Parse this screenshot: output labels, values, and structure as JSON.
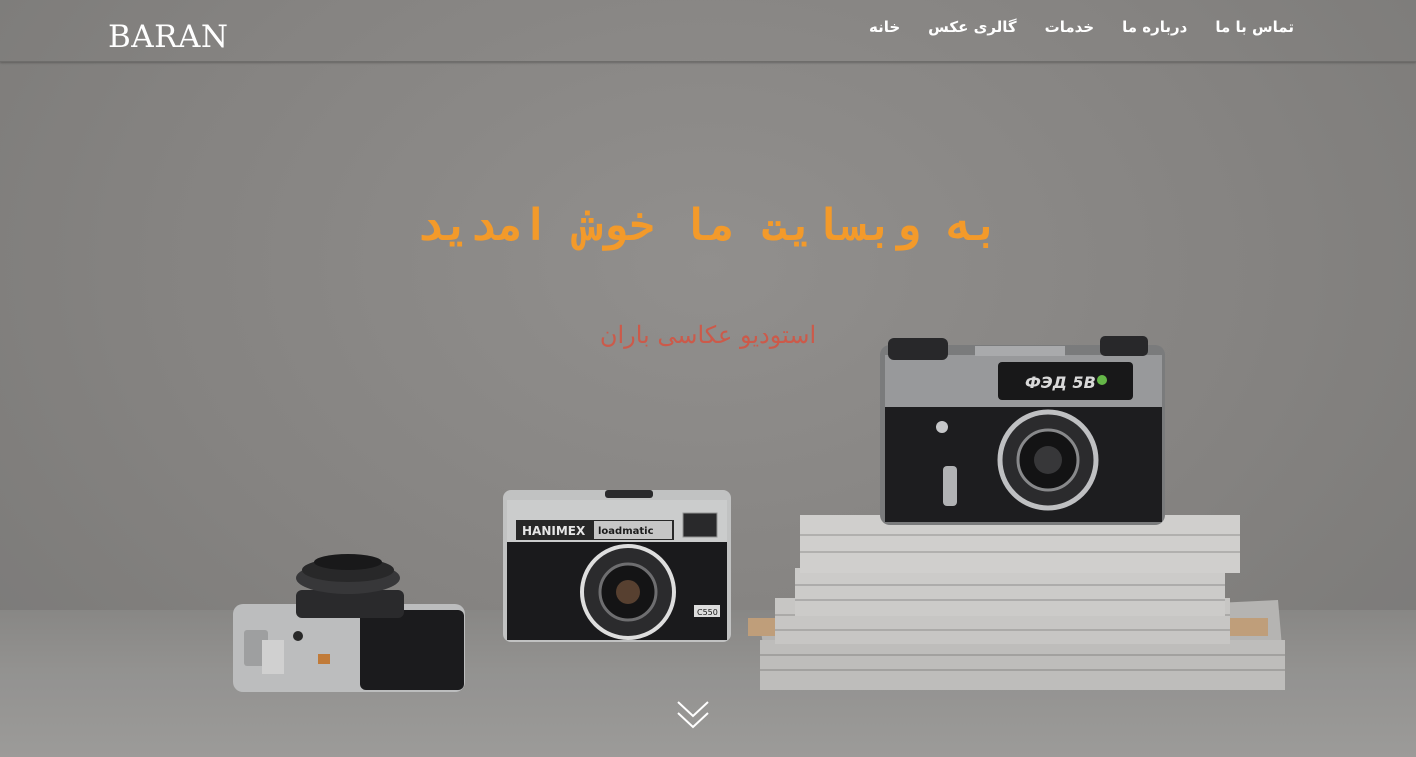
{
  "header": {
    "logo": "BARAN",
    "nav": [
      {
        "label": "خانه"
      },
      {
        "label": "گالری عکس"
      },
      {
        "label": "خدمات"
      },
      {
        "label": "درباره ما"
      },
      {
        "label": "تماس با ما"
      }
    ]
  },
  "hero": {
    "headline": "به وبسایت ما خوش امدید",
    "subtitle": "استودیو عکاسی باران",
    "scroll_icon": "double-chevron-down-icon",
    "cameras": [
      {
        "brand": "ФЭД 5В"
      },
      {
        "brand": "HANIMEX",
        "model": "loadmatic",
        "badge": "C550"
      }
    ]
  },
  "colors": {
    "headline": "#f39a2a",
    "subtitle": "#cc5a4a",
    "nav_text": "#ffffff",
    "background": "#8a8988"
  }
}
